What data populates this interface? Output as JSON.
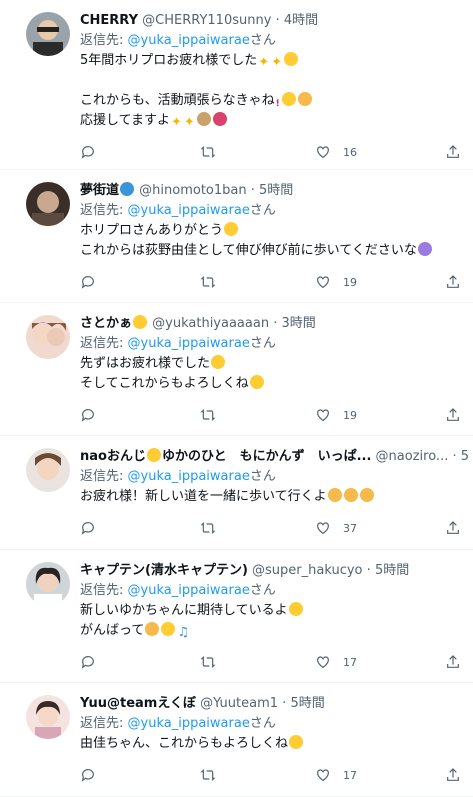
{
  "tweets": [
    {
      "name": "CHERRY",
      "handle": "@CHERRY110sunny",
      "time": "4時間",
      "reply_prefix": "返信先: ",
      "reply_handle": "@yuka_ippaiwarae",
      "reply_suffix": "さん",
      "lines": [
        "5年間ホリプロお疲れ様でした",
        "",
        "これからも、活動頑張らなきゃね",
        "応援してますよ"
      ],
      "likes": "16"
    },
    {
      "name": "夢街道",
      "handle": "@hinomoto1ban",
      "time": "5時間",
      "reply_prefix": "返信先: ",
      "reply_handle": "@yuka_ippaiwarae",
      "reply_suffix": "さん",
      "lines": [
        "ホリプロさんありがとう",
        "これからは荻野由佳として伸び伸び前に歩いてくださいな"
      ],
      "likes": "19"
    },
    {
      "name": "さとかぁ",
      "handle": "@yukathiyaaaaan",
      "time": "3時間",
      "reply_prefix": "返信先: ",
      "reply_handle": "@yuka_ippaiwarae",
      "reply_suffix": "さん",
      "lines": [
        "先ずはお疲れ様でした",
        "そしてこれからもよろしくね"
      ],
      "likes": "19"
    },
    {
      "name": "naoおんじ",
      "name_suffix": "ゆかのひと　もにかんず　いっぱ...",
      "handle": "@naoziro...",
      "time": "5",
      "reply_prefix": "返信先: ",
      "reply_handle": "@yuka_ippaiwarae",
      "reply_suffix": "さん",
      "lines": [
        "お疲れ様！新しい道を一緒に歩いて行くよ"
      ],
      "likes": "37"
    },
    {
      "name": "キャプテン(清水キャプテン)",
      "handle": "@super_hakucyo",
      "time": "5時間",
      "reply_prefix": "返信先: ",
      "reply_handle": "@yuka_ippaiwarae",
      "reply_suffix": "さん",
      "lines": [
        "新しいゆかちゃんに期待しているよ",
        "がんばって"
      ],
      "likes": "17"
    },
    {
      "name": "Yuu@teamえくぼ",
      "handle": "@Yuuteam1",
      "time": "5時間",
      "reply_prefix": "返信先: ",
      "reply_handle": "@yuka_ippaiwarae",
      "reply_suffix": "さん",
      "lines": [
        "由佳ちゃん、これからもよろしくね"
      ],
      "likes": "17"
    }
  ],
  "dot": "·",
  "colors": {
    "accent": "#1d9bf0",
    "muted": "#536471",
    "text": "#0f1419",
    "divider": "#eff3f4"
  },
  "icons": [
    "reply-icon",
    "retweet-icon",
    "like-icon",
    "share-icon"
  ]
}
